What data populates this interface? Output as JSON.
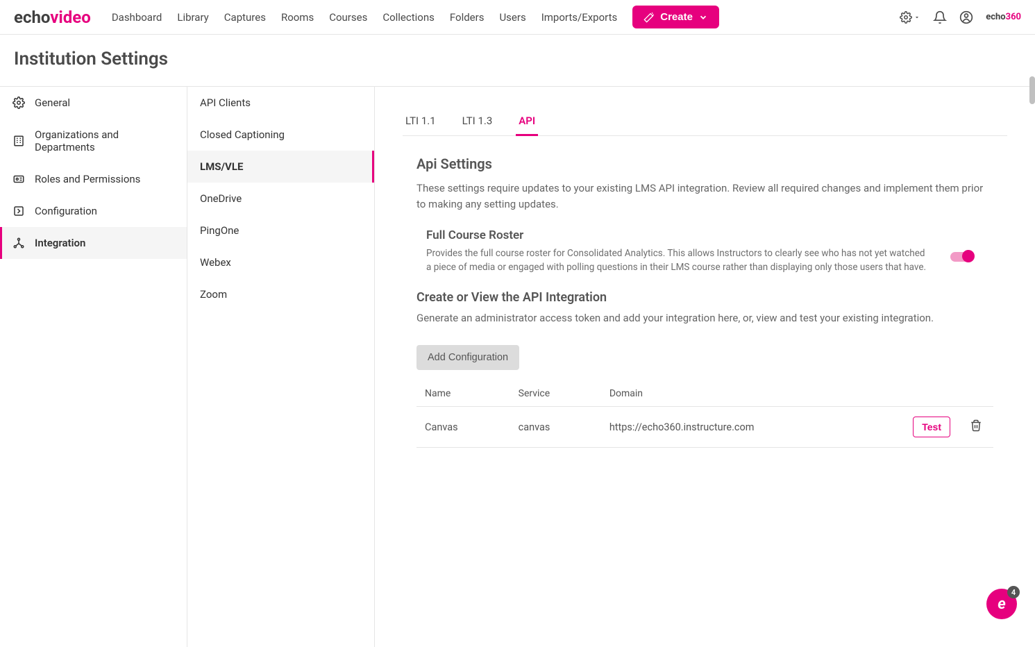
{
  "brand": {
    "part1": "echo",
    "part2": "video"
  },
  "smallbrand": {
    "part1": "echo",
    "part2": "360"
  },
  "topnav": {
    "links": [
      "Dashboard",
      "Library",
      "Captures",
      "Rooms",
      "Courses",
      "Collections",
      "Folders",
      "Users",
      "Imports/Exports"
    ],
    "create_label": "Create"
  },
  "page_title": "Institution Settings",
  "sidebar1": {
    "items": [
      {
        "label": "General",
        "icon": "gear"
      },
      {
        "label": "Organizations and Departments",
        "icon": "building"
      },
      {
        "label": "Roles and Permissions",
        "icon": "badge"
      },
      {
        "label": "Configuration",
        "icon": "arrow-box"
      },
      {
        "label": "Integration",
        "icon": "nodes",
        "active": true
      }
    ]
  },
  "sidebar2": {
    "items": [
      {
        "label": "API Clients"
      },
      {
        "label": "Closed Captioning"
      },
      {
        "label": "LMS/VLE",
        "active": true
      },
      {
        "label": "OneDrive"
      },
      {
        "label": "PingOne"
      },
      {
        "label": "Webex"
      },
      {
        "label": "Zoom"
      }
    ]
  },
  "tabs": [
    {
      "label": "LTI 1.1"
    },
    {
      "label": "LTI 1.3"
    },
    {
      "label": "API",
      "active": true
    }
  ],
  "api": {
    "heading": "Api Settings",
    "desc": "These settings require updates to your existing LMS API integration. Review all required changes and implement them prior to making any setting updates.",
    "roster_title": "Full Course Roster",
    "roster_desc": "Provides the full course roster for Consolidated Analytics. This allows Instructors to clearly see who has not yet watched a piece of media or engaged with polling questions in their LMS course rather than displaying only those users that have.",
    "create_view_heading": "Create or View the API Integration",
    "create_view_desc": "Generate an administrator access token and add your integration here, or, view and test your existing integration.",
    "add_btn": "Add Configuration",
    "table": {
      "headers": [
        "Name",
        "Service",
        "Domain"
      ],
      "rows": [
        {
          "name": "Canvas",
          "service": "canvas",
          "domain": "https://echo360.instructure.com",
          "test_label": "Test"
        }
      ]
    }
  },
  "float": {
    "letter": "e",
    "count": "4"
  }
}
